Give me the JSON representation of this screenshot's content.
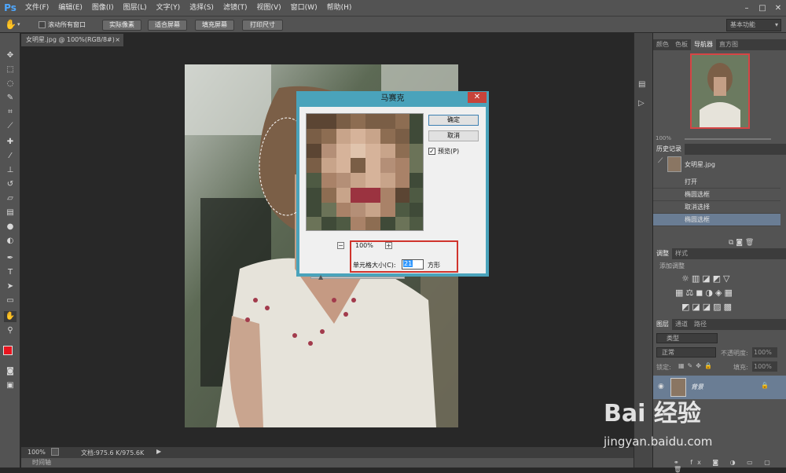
{
  "app": {
    "logo": "Ps"
  },
  "menubar": {
    "items": [
      "文件(F)",
      "编辑(E)",
      "图像(I)",
      "图层(L)",
      "文字(Y)",
      "选择(S)",
      "滤镜(T)",
      "视图(V)",
      "窗口(W)",
      "帮助(H)"
    ]
  },
  "optionsbar": {
    "scroll_all": "滚动所有窗口",
    "actual_pixels": "实际像素",
    "fit_screen": "适合屏幕",
    "fill_screen": "填充屏幕",
    "print_size": "打印尺寸",
    "workspace": "基本功能"
  },
  "document": {
    "tab": "女明星.jpg @ 100%(RGB/8#)",
    "zoom": "100%",
    "doc_info": "文档:975.6 K/975.6K",
    "timeline": "时间轴"
  },
  "panels": {
    "top_tabs": [
      "颜色",
      "色板",
      "导航器",
      "直方图"
    ],
    "nav_zoom": "100%",
    "history_title": "历史记录",
    "history_snapshot": "女明星.jpg",
    "history_items": [
      "打开",
      "椭圆选框",
      "取消选择",
      "椭圆选框"
    ],
    "adjust_tabs": [
      "调整",
      "样式"
    ],
    "adjust_title": "添加调整",
    "layers_tabs": [
      "图层",
      "通道",
      "路径"
    ],
    "layers_kind": "类型",
    "blend_mode": "正常",
    "opacity_label": "不透明度:",
    "opacity_value": "100%",
    "lock_label": "锁定:",
    "fill_label": "填充:",
    "fill_value": "100%",
    "layer_name": "背景"
  },
  "dialog": {
    "title": "马赛克",
    "ok": "确定",
    "cancel": "取消",
    "preview_label": "预览(P)",
    "zoom": "100%",
    "cell_size_label": "单元格大小(C):",
    "cell_size_value": "21",
    "unit": "方形"
  },
  "watermark": {
    "brand": "Bai 经验",
    "url": "jingyan.baidu.com"
  },
  "colors": {
    "foreground": "#e8141e",
    "background": "#6b1ee0",
    "dialog_border": "#4aa3bb",
    "highlight": "#d0342c"
  }
}
